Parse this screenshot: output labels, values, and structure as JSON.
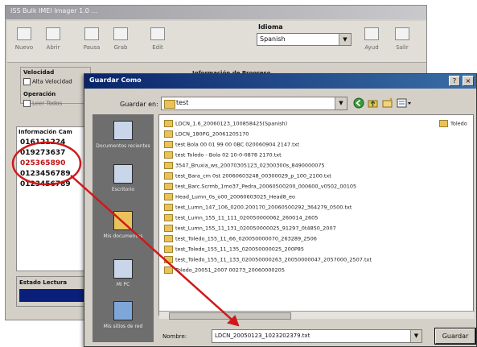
{
  "back_window": {
    "title": "ISS Bulk IMEI Imager 1.0 ...",
    "toolbar": {
      "buttons": [
        {
          "label": "Nuevo",
          "icon": "new-icon"
        },
        {
          "label": "Abrir",
          "icon": "open-icon"
        },
        {
          "label": "Pausa",
          "icon": "pause-icon"
        },
        {
          "label": "Grab",
          "icon": "record-icon"
        },
        {
          "label": "Edit",
          "icon": "edit-icon"
        }
      ],
      "right_buttons": [
        {
          "label": "Ayud",
          "icon": "help-icon"
        },
        {
          "label": "Salir",
          "icon": "exit-icon"
        }
      ],
      "idioma_label": "Idioma",
      "idioma_value": "Spanish"
    },
    "velocidad_title": "Velocidad",
    "alta_label": "Alta Velocidad",
    "operacion_title": "Operación",
    "leer_label": "Leer Todos",
    "info_progreso": "Información de Progreso",
    "info_panel_title": "Información Cam",
    "imei_list": [
      "016121224",
      "019273637",
      "025365890",
      "0123456789",
      "0123456789"
    ],
    "estado_label": "Estado Lectura"
  },
  "dialog": {
    "title": "Guardar Como",
    "help_btn": "?",
    "close_btn": "×",
    "buscar_label": "Guardar en:",
    "folder": "test",
    "places": [
      {
        "label": "Documentos recientes",
        "icon": "recent-documents-icon"
      },
      {
        "label": "Escritorio",
        "icon": "desktop-icon"
      },
      {
        "label": "Mis documentos",
        "icon": "my-documents-icon"
      },
      {
        "label": "Mi PC",
        "icon": "my-computer-icon"
      },
      {
        "label": "Mis sitios de red",
        "icon": "network-places-icon"
      }
    ],
    "files": [
      "LDCN_1.6_20060123_100858425(Spanish)",
      "LDCN_180PG_20061205170",
      "test Bola 00 01 99 00 0BC 020060904 2147.txt",
      "test Toledo - Bola 02 10-0-0878 2170.txt",
      "3547_Bruxia_ws_20070305123_02300300s_8490000075",
      "test_Bara_cm 0st 20060603248_00300029_p_100_2100.txt",
      "test_Barc.Scrmb_1mo37_Pedra_20060500200_000600_v0502_00105",
      "Head_Lumn_0s_o00_20060603025_Head8_eo",
      "test_Lumn_147_106_0200.200170_20060500292_364279_0500.txt",
      "test_Lumn_155_11_111_020050000062_260014_2605",
      "test_Lumn_155_11_131_020050000025_91297_0t4850_2007",
      "test_Toledo_155_11_66_020050000070_263289_2506",
      "test_Toledo_155_11_135_020050000025_200P85",
      "test_Toledo_155_11_133_020050000263_20050000047_2057000_2507.txt",
      "Toledo_20051_2007 00273_20060000205"
    ],
    "extra_folder": "Toledo",
    "nombre_label": "Nombre:",
    "nombre_value": "LDCN_20050123_1023202379.txt",
    "guardar_label": "Guardar"
  },
  "colors": {
    "annotation": "#d01818",
    "title_blue": "#0a246a",
    "progress_blue": "#0a1f7a"
  }
}
